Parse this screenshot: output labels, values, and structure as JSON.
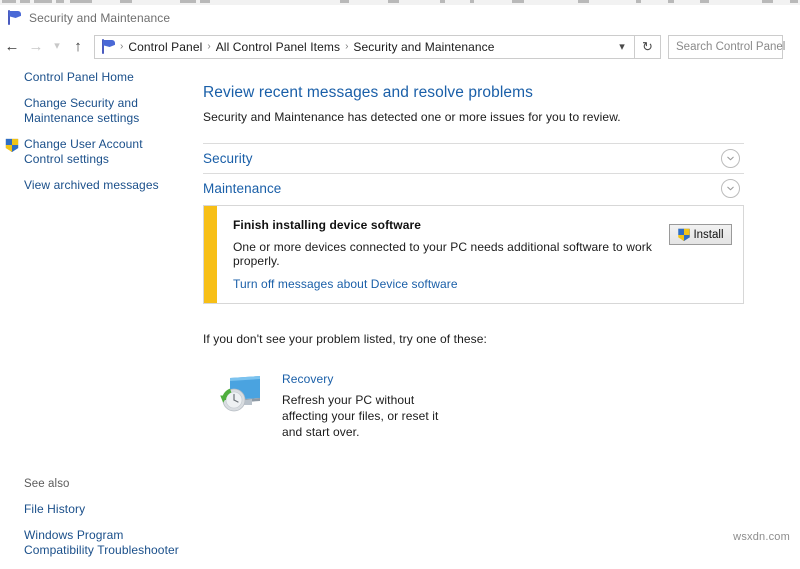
{
  "window": {
    "title": "Security and Maintenance",
    "title_icon": "flag-icon"
  },
  "nav": {
    "back_icon": "arrow-left-icon",
    "forward_icon": "arrow-right-icon",
    "recent_icon": "chevron-down-icon",
    "up_icon": "arrow-up-icon",
    "address_icon": "flag-icon",
    "breadcrumbs": [
      "Control Panel",
      "All Control Panel Items",
      "Security and Maintenance"
    ],
    "separator": "›",
    "dropdown_icon": "chevron-down-icon",
    "refresh_icon": "refresh-icon",
    "search_placeholder": "Search Control Panel"
  },
  "sidebar": {
    "items": [
      {
        "label": "Control Panel Home",
        "icon": null
      },
      {
        "label": "Change Security and Maintenance settings",
        "icon": null
      },
      {
        "label": "Change User Account Control settings",
        "icon": "uac-shield-icon"
      },
      {
        "label": "View archived messages",
        "icon": null
      }
    ],
    "see_also": {
      "heading": "See also",
      "links": [
        "File History",
        "Windows Program Compatibility Troubleshooter"
      ]
    }
  },
  "main": {
    "heading": "Review recent messages and resolve problems",
    "subtitle": "Security and Maintenance has detected one or more issues for you to review.",
    "sections": [
      {
        "title": "Security",
        "expand_icon": "chevron-down-circle-icon"
      },
      {
        "title": "Maintenance",
        "expand_icon": "chevron-down-circle-icon"
      }
    ],
    "alert": {
      "accent_color": "#f7bf16",
      "title": "Finish installing device software",
      "description": "One or more devices connected to your PC needs additional software to work properly.",
      "link": "Turn off messages about Device software",
      "button": {
        "label": "Install",
        "icon": "uac-shield-icon"
      }
    },
    "try_text": "If you don't see your problem listed, try one of these:",
    "recovery": {
      "icon": "recovery-monitor-icon",
      "title": "Recovery",
      "description": "Refresh your PC without affecting your files, or reset it and start over."
    }
  },
  "watermark": "wsxdn.com",
  "colors": {
    "link_blue": "#1a5fa8",
    "sidebar_link": "#1a4f8a",
    "accent_yellow": "#f7bf16",
    "shield_blue": "#2f6ec4",
    "shield_yellow": "#f0c419"
  }
}
